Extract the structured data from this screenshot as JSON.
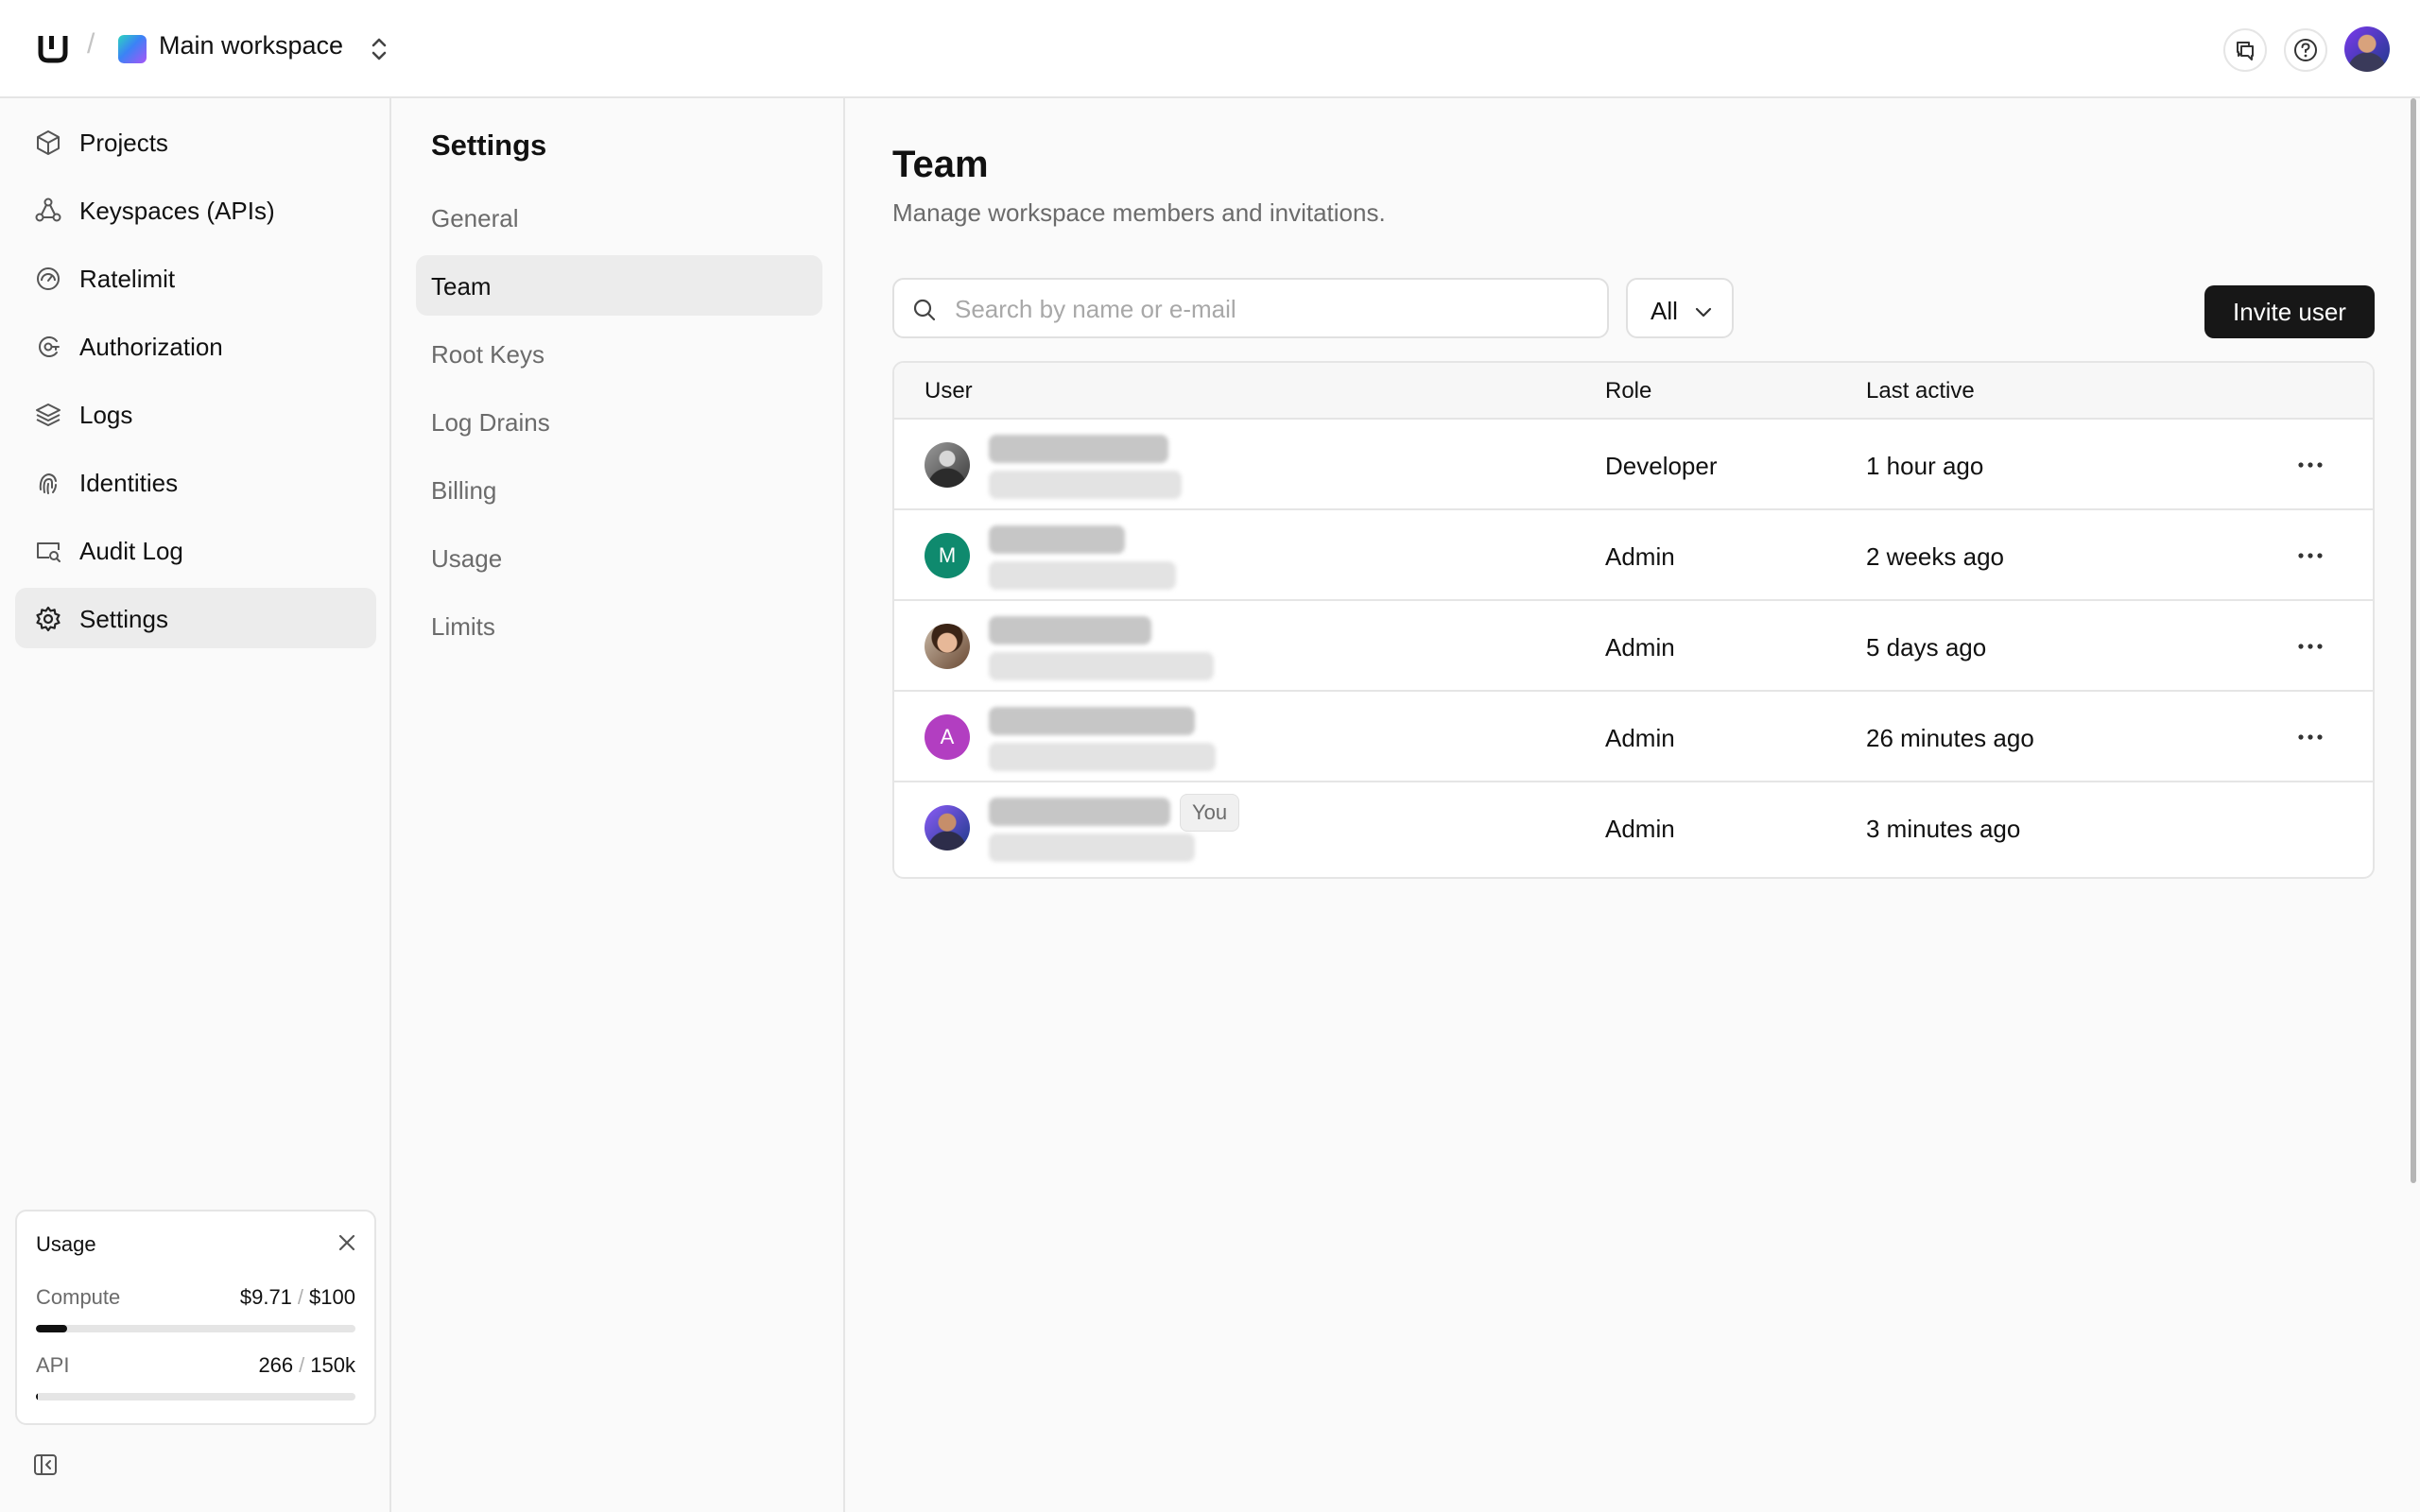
{
  "workspace": {
    "name": "Main workspace"
  },
  "sidebar": {
    "items": [
      {
        "label": "Projects",
        "icon": "cube-icon"
      },
      {
        "label": "Keyspaces (APIs)",
        "icon": "nodes-icon"
      },
      {
        "label": "Ratelimit",
        "icon": "gauge-icon"
      },
      {
        "label": "Authorization",
        "icon": "shield-key-icon"
      },
      {
        "label": "Logs",
        "icon": "layers-icon"
      },
      {
        "label": "Identities",
        "icon": "fingerprint-icon"
      },
      {
        "label": "Audit Log",
        "icon": "monitor-search-icon"
      },
      {
        "label": "Settings",
        "icon": "gear-icon",
        "active": true
      }
    ]
  },
  "usage": {
    "title": "Usage",
    "compute": {
      "label": "Compute",
      "used": "$9.71",
      "limit": "$100",
      "fraction": 0.0971
    },
    "api": {
      "label": "API",
      "used": "266",
      "limit": "150k",
      "fraction": 0.0018
    }
  },
  "settings_nav": {
    "title": "Settings",
    "items": [
      {
        "label": "General"
      },
      {
        "label": "Team",
        "active": true
      },
      {
        "label": "Root Keys"
      },
      {
        "label": "Log Drains"
      },
      {
        "label": "Billing"
      },
      {
        "label": "Usage"
      },
      {
        "label": "Limits"
      }
    ]
  },
  "page": {
    "title": "Team",
    "subtitle": "Manage workspace members and invitations."
  },
  "search": {
    "placeholder": "Search by name or e-mail",
    "value": ""
  },
  "filter": {
    "label": "All"
  },
  "invite_button": "Invite user",
  "table": {
    "headers": {
      "user": "User",
      "role": "Role",
      "last_active": "Last active"
    },
    "rows": [
      {
        "avatar": "photo",
        "initial": "",
        "role": "Developer",
        "last_active": "1 hour ago",
        "actions": true,
        "you": false
      },
      {
        "avatar": "initial",
        "initial": "M",
        "avatar_color": "#0f8a6e",
        "role": "Admin",
        "last_active": "2 weeks ago",
        "actions": true,
        "you": false
      },
      {
        "avatar": "photo",
        "initial": "",
        "role": "Admin",
        "last_active": "5 days ago",
        "actions": true,
        "you": false
      },
      {
        "avatar": "initial",
        "initial": "A",
        "avatar_color": "#b23ec1",
        "role": "Admin",
        "last_active": "26 minutes ago",
        "actions": true,
        "you": false
      },
      {
        "avatar": "photo",
        "initial": "",
        "role": "Admin",
        "last_active": "3 minutes ago",
        "actions": false,
        "you": true,
        "you_label": "You"
      }
    ]
  }
}
